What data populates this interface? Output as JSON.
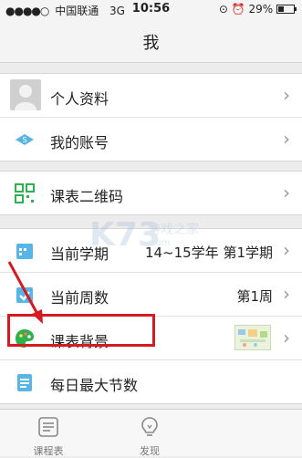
{
  "status_bar": {
    "signal": "●●●●○",
    "carrier": "中国联通",
    "network": "3G",
    "time": "10:56",
    "battery": "29%"
  },
  "header": {
    "title": "我"
  },
  "groups": [
    {
      "items": [
        {
          "label": "个人资料",
          "icon": "avatar-placeholder"
        },
        {
          "label": "我的账号",
          "icon": "account-badge-icon"
        }
      ]
    },
    {
      "items": [
        {
          "label": "课表二维码",
          "icon": "qrcode-icon"
        }
      ]
    },
    {
      "items": [
        {
          "label": "当前学期",
          "value": "14~15学年 第1学期",
          "icon": "calendar-icon"
        },
        {
          "label": "当前周数",
          "value": "第1周",
          "icon": "check-calendar-icon"
        },
        {
          "label": "课表背景",
          "icon": "palette-icon"
        },
        {
          "label": "每日最大节数",
          "icon": "list-icon"
        }
      ]
    }
  ],
  "tabs": [
    {
      "label": "课程表",
      "icon": "schedule-tab-icon"
    },
    {
      "label": "发现",
      "icon": "discover-bulb-icon"
    }
  ],
  "watermark": {
    "brand": "K73",
    "cn": "游戏之家",
    "url": ".com"
  },
  "colors": {
    "highlight": "#d71920",
    "chevron": "#9a9a9a",
    "icon_blue": "#58b5e6",
    "icon_green": "#2fb14f"
  }
}
